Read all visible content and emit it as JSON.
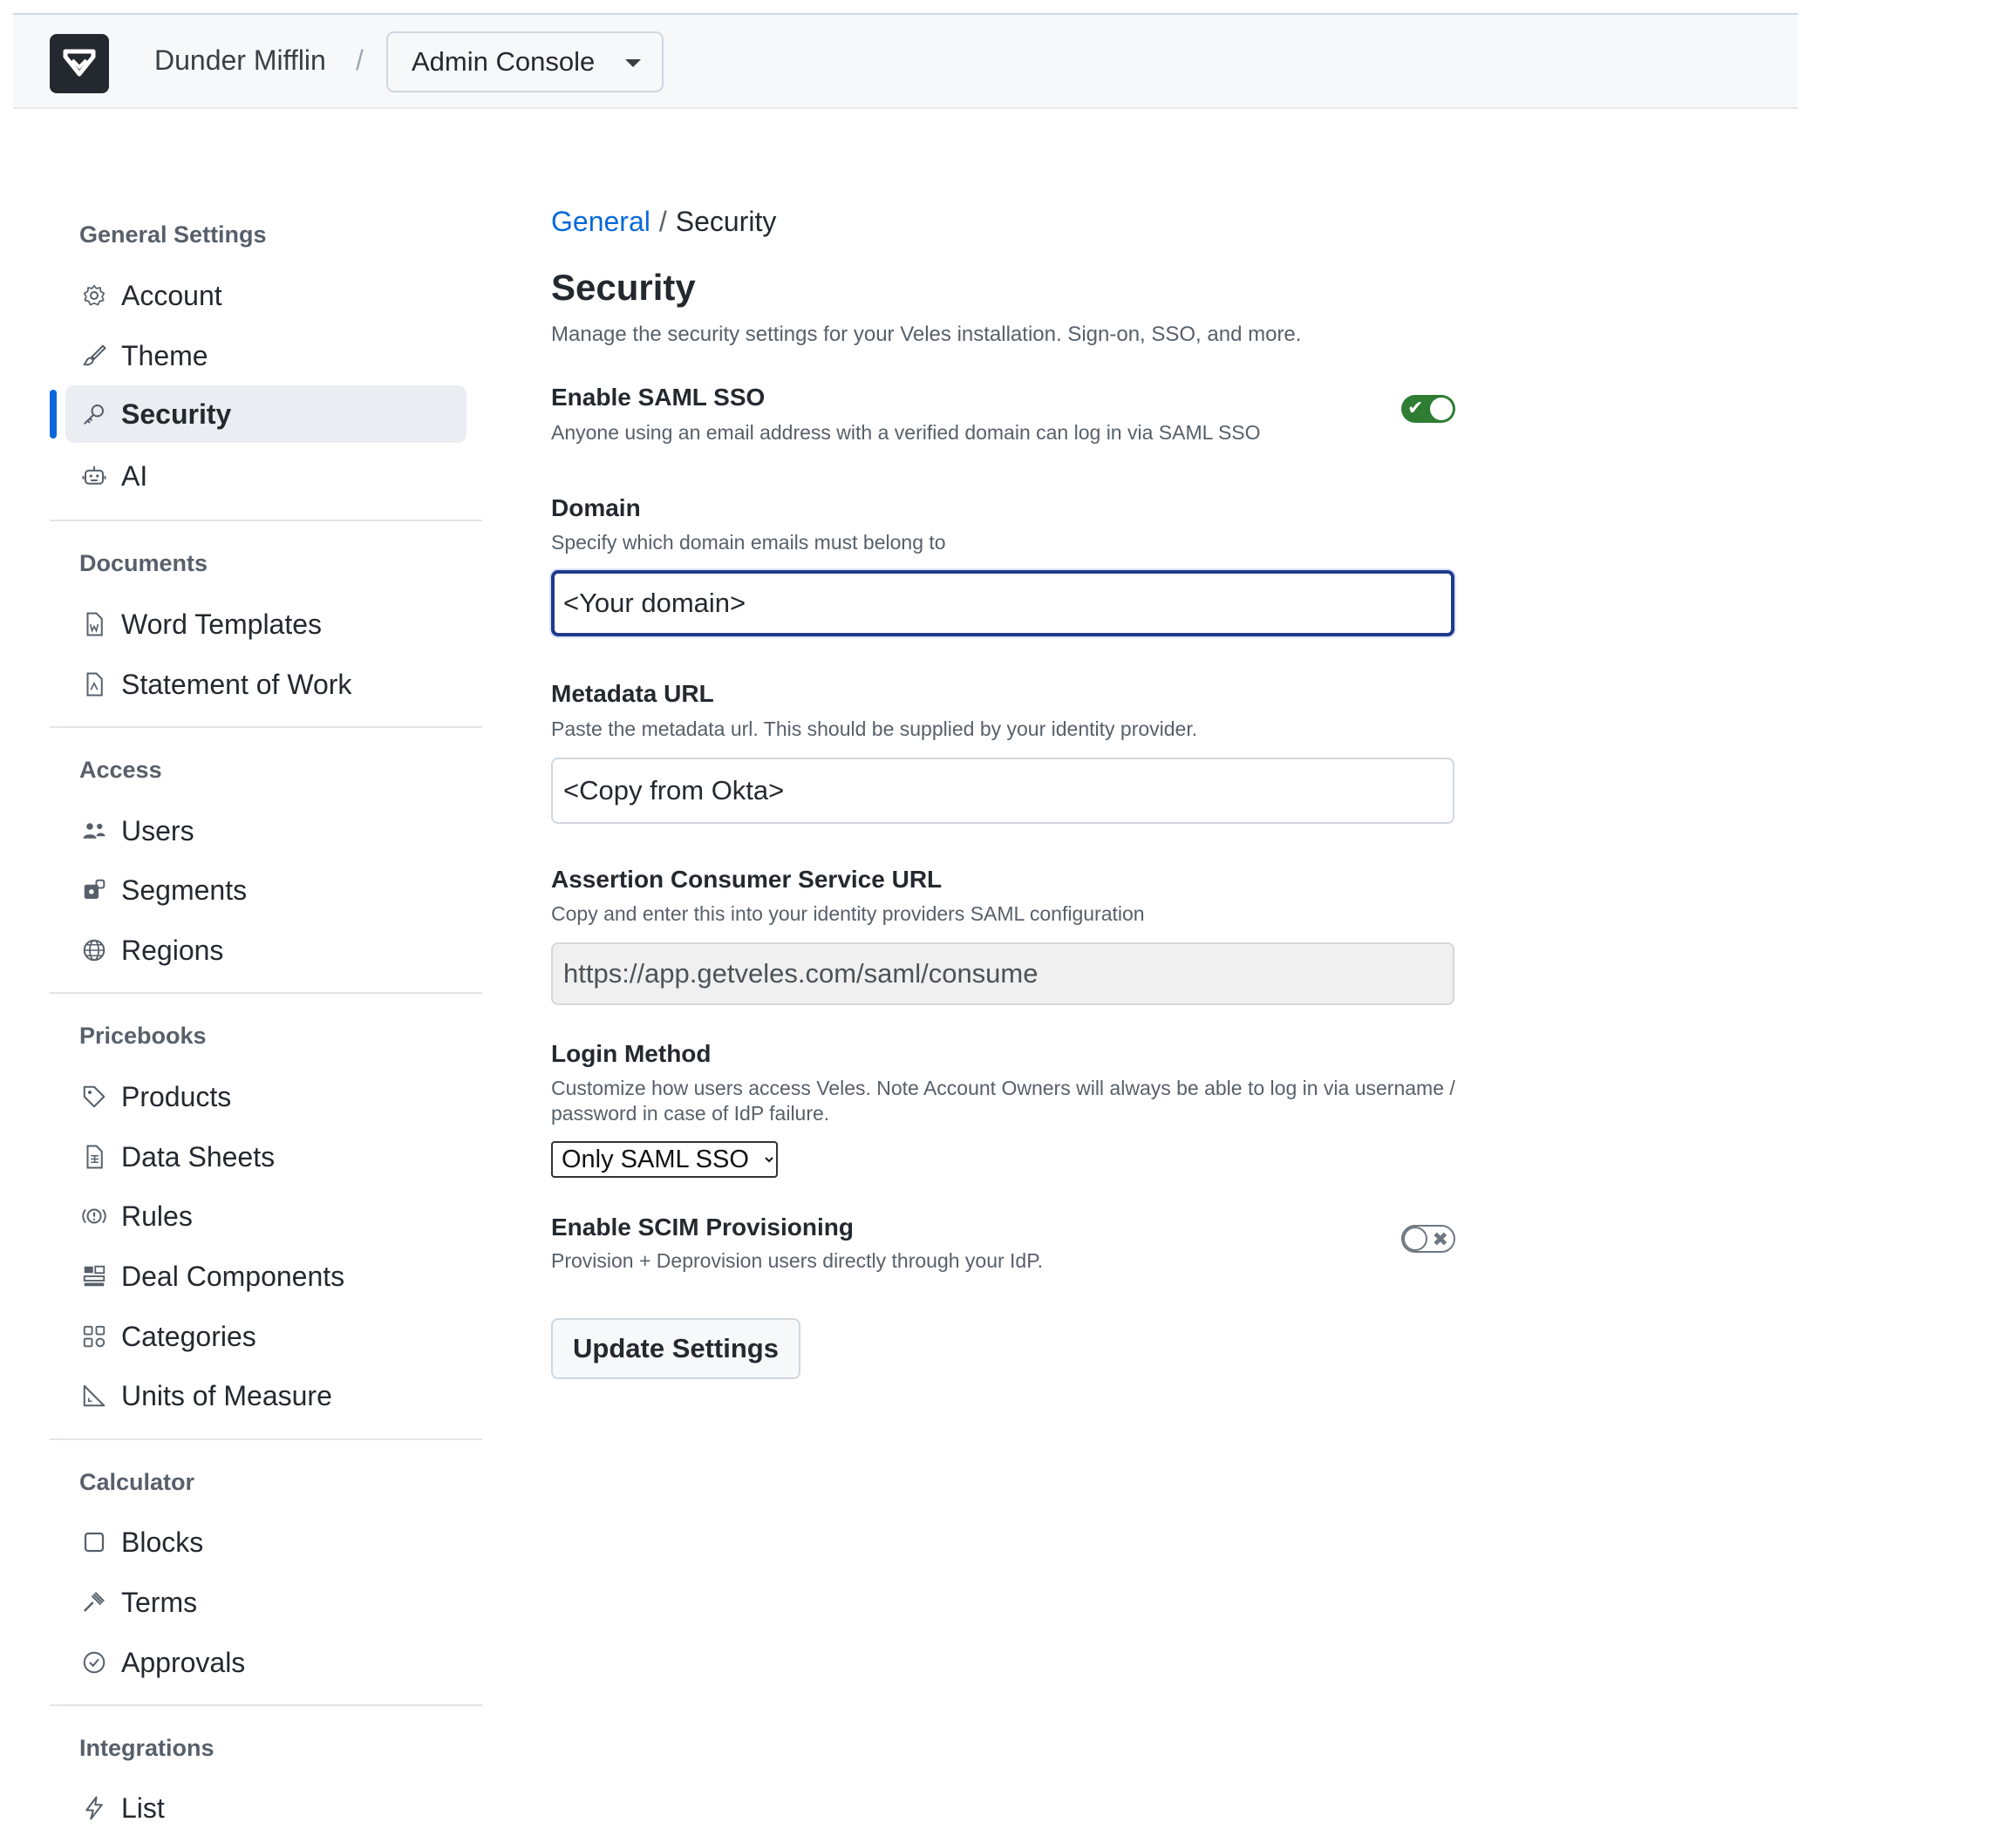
{
  "header": {
    "org_name": "Dunder Mifflin",
    "separator": "/",
    "console_label": "Admin Console"
  },
  "sidebar": {
    "groups": [
      {
        "title": "General Settings",
        "items": [
          {
            "label": "Account",
            "icon": "gear-icon"
          },
          {
            "label": "Theme",
            "icon": "brush-icon"
          },
          {
            "label": "Security",
            "icon": "key-icon",
            "active": true
          },
          {
            "label": "AI",
            "icon": "robot-icon"
          }
        ]
      },
      {
        "title": "Documents",
        "items": [
          {
            "label": "Word Templates",
            "icon": "word-file-icon"
          },
          {
            "label": "Statement of Work",
            "icon": "document-icon"
          }
        ]
      },
      {
        "title": "Access",
        "items": [
          {
            "label": "Users",
            "icon": "users-icon"
          },
          {
            "label": "Segments",
            "icon": "segments-icon"
          },
          {
            "label": "Regions",
            "icon": "globe-icon"
          }
        ]
      },
      {
        "title": "Pricebooks",
        "items": [
          {
            "label": "Products",
            "icon": "tag-icon"
          },
          {
            "label": "Data Sheets",
            "icon": "sheet-icon"
          },
          {
            "label": "Rules",
            "icon": "rules-icon"
          },
          {
            "label": "Deal Components",
            "icon": "components-icon"
          },
          {
            "label": "Categories",
            "icon": "categories-icon"
          },
          {
            "label": "Units of Measure",
            "icon": "ruler-icon"
          }
        ]
      },
      {
        "title": "Calculator",
        "items": [
          {
            "label": "Blocks",
            "icon": "square-icon"
          },
          {
            "label": "Terms",
            "icon": "gavel-icon"
          },
          {
            "label": "Approvals",
            "icon": "check-circle-icon"
          }
        ]
      },
      {
        "title": "Integrations",
        "items": [
          {
            "label": "List",
            "icon": "lightning-icon"
          }
        ]
      }
    ]
  },
  "breadcrumb": {
    "parent": "General",
    "separator": "/",
    "current": "Security"
  },
  "page": {
    "title": "Security",
    "description": "Manage the security settings for your Veles installation. Sign-on, SSO, and more."
  },
  "saml": {
    "label": "Enable SAML SSO",
    "help": "Anyone using an email address with a verified domain can log in via SAML SSO",
    "enabled": true,
    "on_mark": "✔"
  },
  "domain": {
    "label": "Domain",
    "help": "Specify which domain emails must belong to",
    "value": "<Your domain>"
  },
  "metadata": {
    "label": "Metadata URL",
    "help": "Paste the metadata url. This should be supplied by your identity provider.",
    "value": "<Copy from Okta>"
  },
  "acs": {
    "label": "Assertion Consumer Service URL",
    "help": "Copy and enter this into your identity providers SAML configuration",
    "value": "https://app.getveles.com/saml/consume"
  },
  "login_method": {
    "label": "Login Method",
    "help": "Customize how users access Veles. Note Account Owners will always be able to log in via username / password in case of IdP failure.",
    "selected": "Only SAML SSO"
  },
  "scim": {
    "label": "Enable SCIM Provisioning",
    "help": "Provision + Deprovision users directly through your IdP.",
    "enabled": false,
    "off_mark": "✖"
  },
  "update_button": "Update Settings"
}
